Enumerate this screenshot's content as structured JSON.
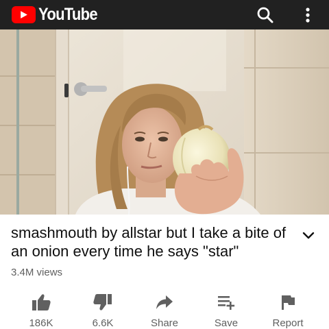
{
  "header": {
    "logo_text": "YouTube",
    "icons": {
      "search": "search-icon",
      "more": "more-vertical-icon"
    }
  },
  "video": {
    "title": "smashmouth by allstar but I take a bite of an onion every time he says \"star\"",
    "views": "3.4M views"
  },
  "actions": {
    "like": {
      "label": "186K",
      "icon": "thumb-up-icon"
    },
    "dislike": {
      "label": "6.6K",
      "icon": "thumb-down-icon"
    },
    "share": {
      "label": "Share",
      "icon": "share-arrow-icon"
    },
    "save": {
      "label": "Save",
      "icon": "playlist-add-icon"
    },
    "report": {
      "label": "Report",
      "icon": "flag-icon"
    }
  },
  "colors": {
    "topbar": "#212121",
    "brand_red": "#ff0000",
    "icon_gray": "#606060",
    "text": "#0f0f0f"
  }
}
